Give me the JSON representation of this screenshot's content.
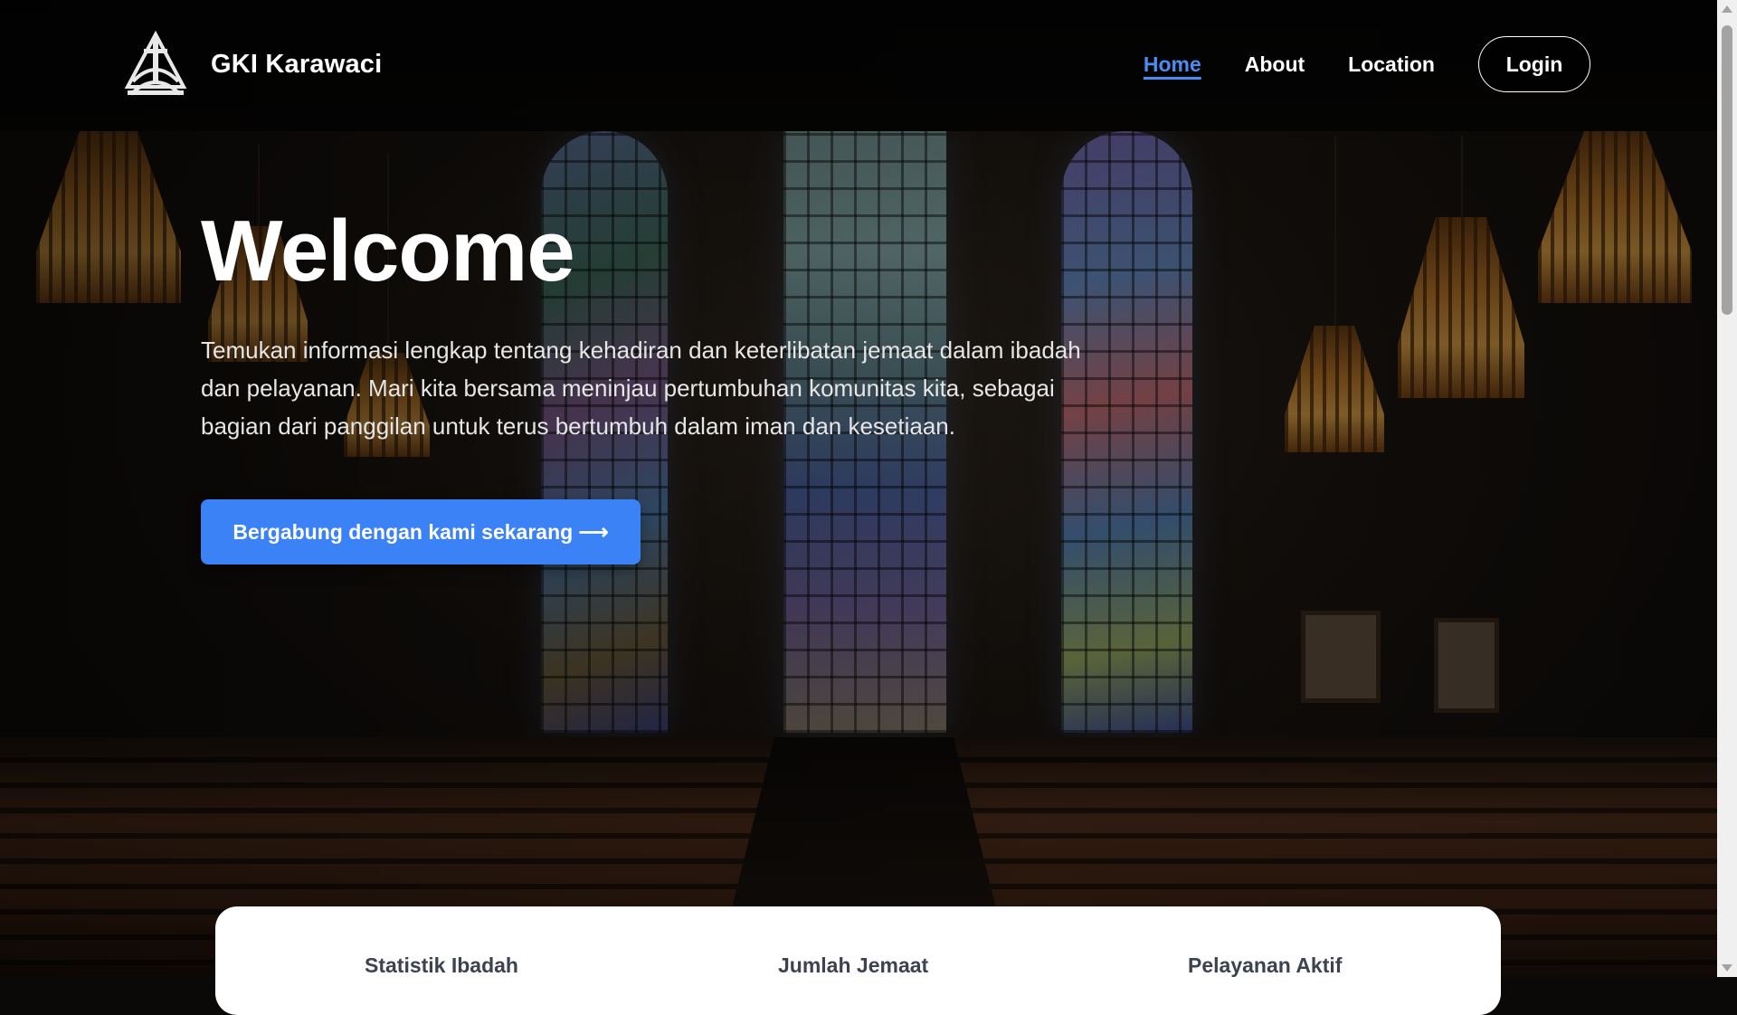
{
  "brand": {
    "name": "GKI Karawaci",
    "logo_icon": "church-cross-logo-icon"
  },
  "nav": {
    "items": [
      {
        "label": "Home",
        "active": true
      },
      {
        "label": "About",
        "active": false
      },
      {
        "label": "Location",
        "active": false
      }
    ],
    "login_label": "Login",
    "active_color": "#4a8cf2"
  },
  "hero": {
    "title": "Welcome",
    "description": "Temukan informasi lengkap tentang kehadiran dan keterlibatan jemaat dalam ibadah dan pelayanan. Mari kita bersama meninjau pertumbuhan komunitas kita, sebagai bagian dari panggilan untuk terus bertumbuh dalam iman dan kesetiaan.",
    "cta_label": "Bergabung dengan kami sekarang ⟶",
    "cta_color": "#3b82f6"
  },
  "stats": {
    "labels": [
      "Statistik Ibadah",
      "Jumlah Jemaat",
      "Pelayanan Aktif"
    ]
  }
}
